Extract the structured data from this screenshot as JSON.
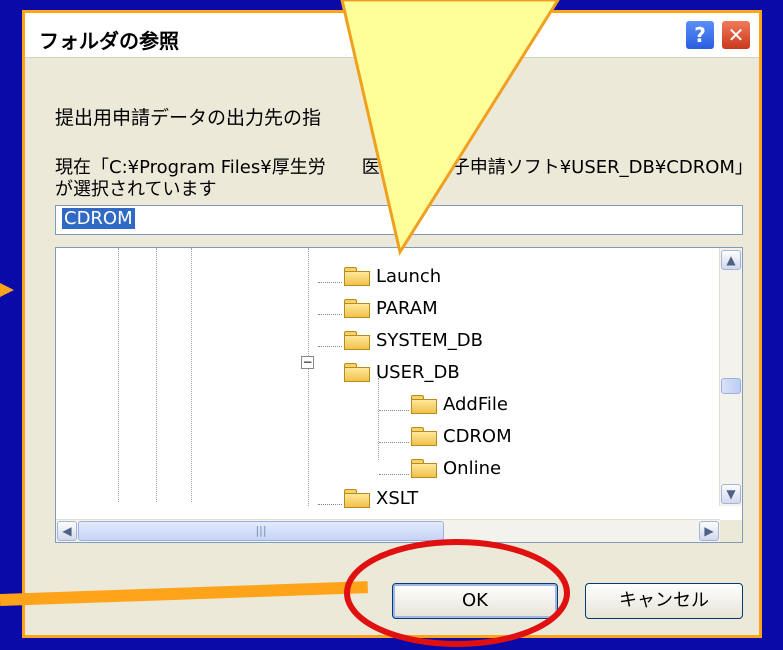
{
  "dialog": {
    "title": "フォルダの参照",
    "help_label": "?",
    "close_label": "✕",
    "instruction": "提出用申請データの出力先の指",
    "current_text": "現在「C:¥Program Files¥厚生労　　医薬品等電子申請ソフト¥USER_DB¥CDROM」が選択されています",
    "path_value": "CDROM",
    "tree": [
      {
        "label": "Launch",
        "level": 0
      },
      {
        "label": "PARAM",
        "level": 0
      },
      {
        "label": "SYSTEM_DB",
        "level": 0
      },
      {
        "label": "USER_DB",
        "level": 0,
        "expanded": true
      },
      {
        "label": "AddFile",
        "level": 1
      },
      {
        "label": "CDROM",
        "level": 1,
        "selected": true
      },
      {
        "label": "Online",
        "level": 1
      },
      {
        "label": "XSLT",
        "level": 0
      }
    ],
    "ok_label": "OK",
    "cancel_label": "キャンセル"
  },
  "annotations": {
    "callout_color": "#ffff99",
    "callout_border": "#f0a020",
    "ellipse_color": "#e01010"
  }
}
